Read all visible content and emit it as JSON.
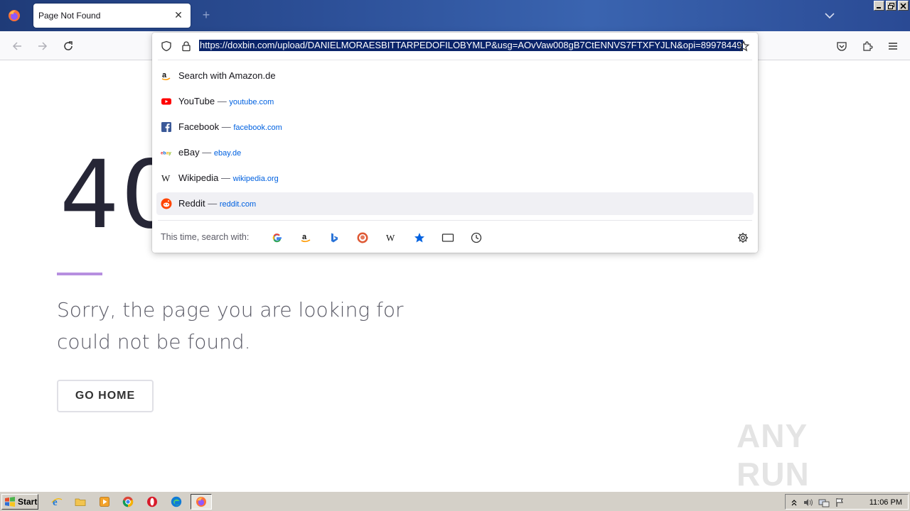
{
  "browser": {
    "tab": {
      "title": "Page Not Found",
      "close_glyph": "✕"
    },
    "new_tab_glyph": "+",
    "url": "https://doxbin.com/upload/DANIELMORAESBITTARPEDOFILOBYMLP&usg=AOvVaw008gB7CtENNVS7FTXFYJLN&opi=89978449"
  },
  "dropdown": {
    "results": [
      {
        "icon": "amazon-icon",
        "title": "Search with Amazon.de",
        "dash": "",
        "url": ""
      },
      {
        "icon": "youtube-icon",
        "title": "YouTube",
        "dash": " — ",
        "url": "youtube.com"
      },
      {
        "icon": "facebook-icon",
        "title": "Facebook",
        "dash": " — ",
        "url": "facebook.com"
      },
      {
        "icon": "ebay-icon",
        "title": "eBay",
        "dash": " — ",
        "url": "ebay.de"
      },
      {
        "icon": "wikipedia-icon",
        "title": "Wikipedia",
        "dash": " — ",
        "url": "wikipedia.org"
      },
      {
        "icon": "reddit-icon",
        "title": "Reddit",
        "dash": " — ",
        "url": "reddit.com"
      }
    ],
    "this_time_label": "This time, search with:",
    "engines": [
      "google-icon",
      "amazon-icon",
      "bing-icon",
      "duckduckgo-icon",
      "wikipedia-icon",
      "bookmarks-star-icon",
      "tabs-icon",
      "history-clock-icon"
    ]
  },
  "page": {
    "error_code": "404",
    "message": "Sorry, the page you are looking for could not be found.",
    "button_label": "GO HOME"
  },
  "watermark": {
    "text": "ANY RUN"
  },
  "taskbar": {
    "start_label": "Start",
    "clock": "11:06 PM"
  },
  "colors": {
    "accent_line": "#b78fe0",
    "url_selection": "#0a246a",
    "link_blue": "#0061e0",
    "titlebar": "#2c4f97"
  }
}
